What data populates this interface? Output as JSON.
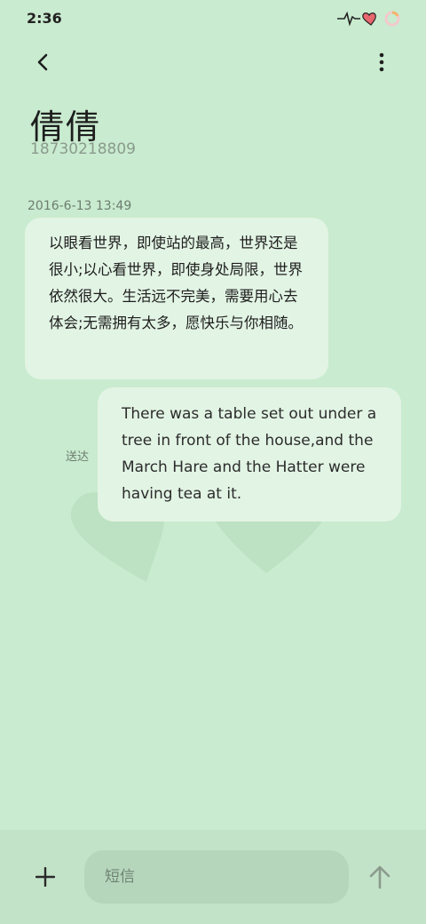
{
  "status_bar": {
    "time": "2:36",
    "icons": [
      "heartbeat-icon",
      "heart-icon",
      "battery-ring-icon"
    ]
  },
  "header": {
    "back_icon": "chevron-left-icon",
    "more_icon": "more-vertical-icon",
    "contact_name": "倩倩",
    "contact_number": "18730218809"
  },
  "conversation": {
    "timestamp": "2016-6-13 13:49",
    "incoming_message": "以眼看世界，即使站的最高，世界还是很小;以心看世界，即使身处局限，世界依然很大。生活远不完美，需要用心去体会;无需拥有太多，愿快乐与你相随。",
    "outgoing_message": "There was a table set out under a tree in front of the house,and the March Hare and the Hatter were having tea at it.",
    "outgoing_status": "送达"
  },
  "composer": {
    "add_icon": "plus-icon",
    "placeholder": "短信",
    "value": "",
    "send_icon": "arrow-up-icon"
  },
  "colors": {
    "background": "#c9ebcf",
    "bubble": "#e2f4e4",
    "input": "#b5d6bb",
    "secondary_text": "#8a9b8d"
  }
}
